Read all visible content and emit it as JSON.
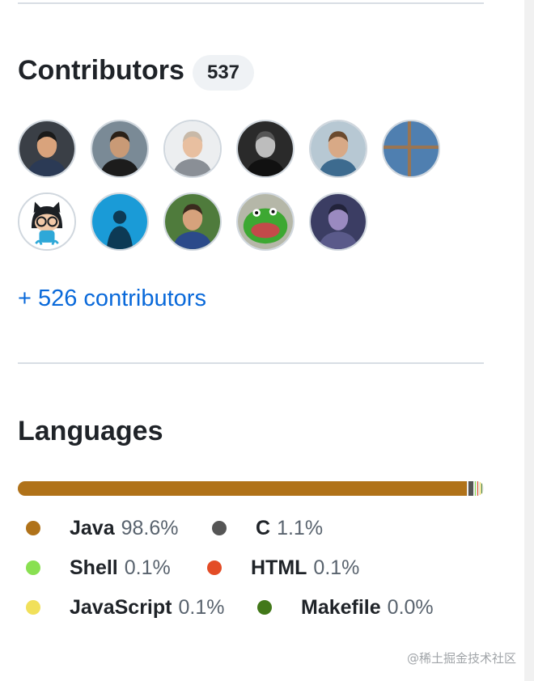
{
  "contributors": {
    "title": "Contributors",
    "count": "537",
    "more_link": "+ 526 contributors",
    "avatars": [
      {
        "name": "avatar-1",
        "bg": "#3a3f46",
        "skin": "#d9a37c",
        "hair": "#1a1a1a",
        "shirt": "#2b3a55"
      },
      {
        "name": "avatar-2",
        "bg": "#7a8a96",
        "skin": "#c99a76",
        "hair": "#2b2118",
        "shirt": "#1c1c1c"
      },
      {
        "name": "avatar-3",
        "bg": "#eceef0",
        "skin": "#e8bfa0",
        "hair": "#c8b9a8",
        "shirt": "#8a8f96"
      },
      {
        "name": "avatar-4",
        "bg": "#2a2a2a",
        "skin": "#bdbdbd",
        "hair": "#555555",
        "shirt": "#111111"
      },
      {
        "name": "avatar-5",
        "bg": "#b7c8d3",
        "skin": "#d8a986",
        "hair": "#6b4a2e",
        "shirt": "#3d6b8f"
      },
      {
        "name": "avatar-6",
        "bg": "#4f7fb0",
        "skin": "#b08a64",
        "hair": "#b08a64",
        "shirt": "#b08a64"
      },
      {
        "name": "avatar-7",
        "bg": "#ffffff",
        "skin": "#1b1f23",
        "hair": "#1b1f23",
        "shirt": "#2ea8d8"
      },
      {
        "name": "avatar-8",
        "bg": "#1a9bd7",
        "skin": "#0d3a55",
        "hair": "#0d3a55",
        "shirt": "#0d3a55"
      },
      {
        "name": "avatar-9",
        "bg": "#4f7b3c",
        "skin": "#d6a27c",
        "hair": "#3a2a1e",
        "shirt": "#2b4a8a"
      },
      {
        "name": "avatar-10",
        "bg": "#b5b7a8",
        "skin": "#3da832",
        "hair": "#2f8a26",
        "shirt": "#c44a4a"
      },
      {
        "name": "avatar-11",
        "bg": "#3b3d63",
        "skin": "#9a8ac0",
        "hair": "#22233a",
        "shirt": "#5a5a8a"
      }
    ]
  },
  "languages": {
    "title": "Languages",
    "items": [
      {
        "name": "Java",
        "percent": "98.6%",
        "value": 98.6,
        "color": "#b07219"
      },
      {
        "name": "C",
        "percent": "1.1%",
        "value": 1.1,
        "color": "#555555"
      },
      {
        "name": "Shell",
        "percent": "0.1%",
        "value": 0.1,
        "color": "#89e051"
      },
      {
        "name": "HTML",
        "percent": "0.1%",
        "value": 0.1,
        "color": "#e34c26"
      },
      {
        "name": "JavaScript",
        "percent": "0.1%",
        "value": 0.1,
        "color": "#f1e05a"
      },
      {
        "name": "Makefile",
        "percent": "0.0%",
        "value": 0.0,
        "color": "#427819"
      }
    ]
  },
  "watermark": "@稀土掘金技术社区"
}
